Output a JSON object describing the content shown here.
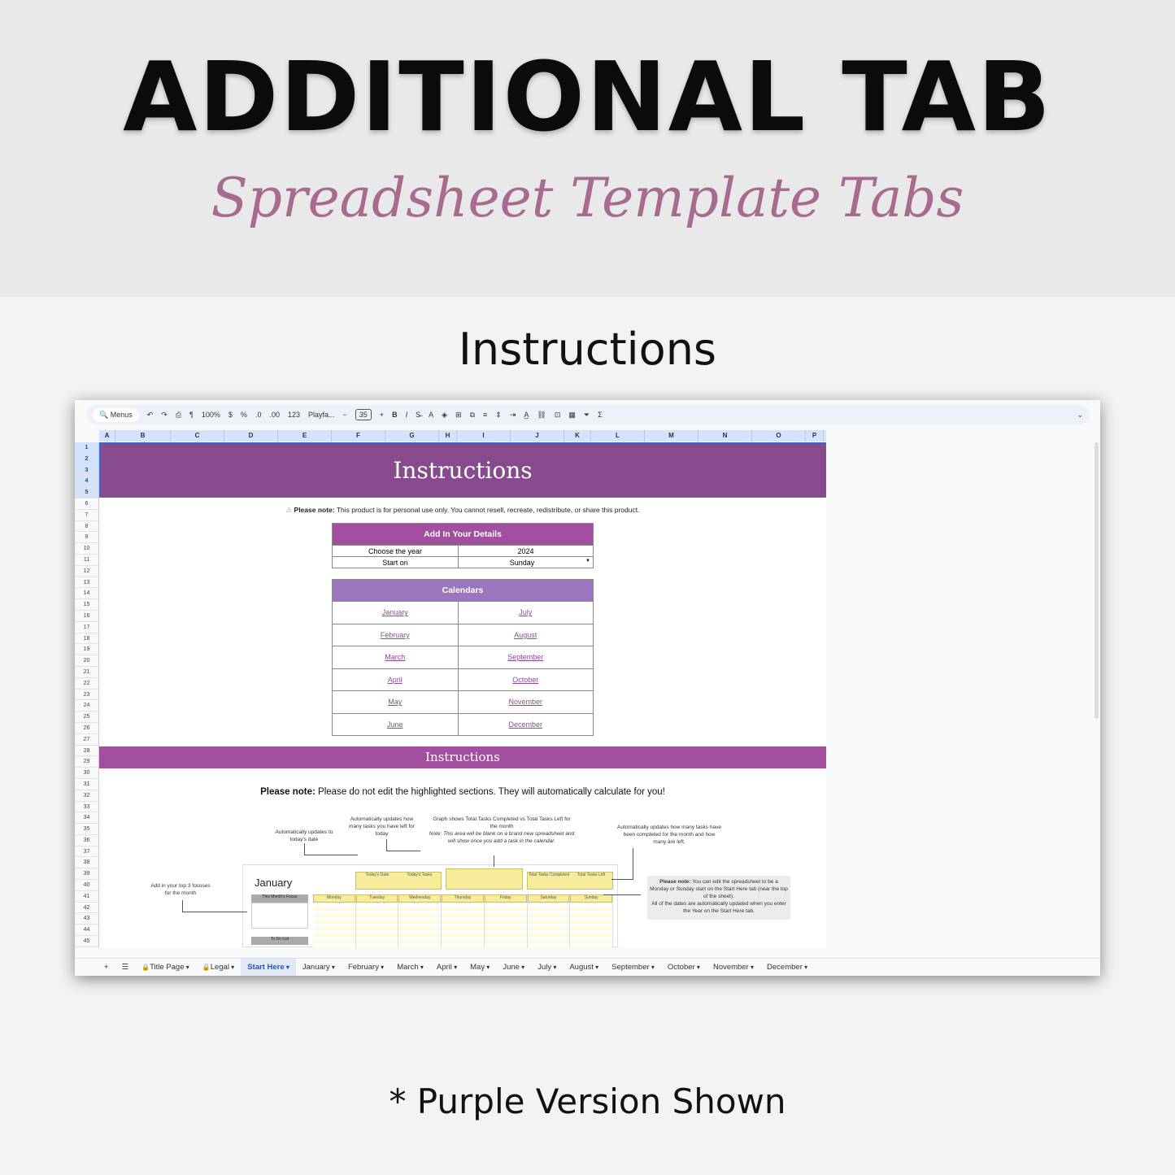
{
  "hero": {
    "title": "ADDITIONAL TAB",
    "subtitle": "Spreadsheet Template Tabs",
    "section": "Instructions",
    "footer": "* Purple Version Shown"
  },
  "toolbar": {
    "search": "Menus",
    "zoom": "100%",
    "currency": "$",
    "percent": "%",
    "dec_minus": ".0",
    "dec_plus": ".00",
    "format": "123",
    "font": "Playfa...",
    "font_size": "35",
    "bold": "B",
    "italic": "I"
  },
  "columns": [
    "A",
    "B",
    "C",
    "D",
    "E",
    "F",
    "G",
    "H",
    "I",
    "J",
    "K",
    "L",
    "M",
    "N",
    "O",
    "P"
  ],
  "sheet": {
    "banner": "Instructions",
    "note_label": "Please note:",
    "note_text": " This product is for personal use only. You cannot resell, recreate, redistribute, or share this product.",
    "details": {
      "header": "Add In Your Details",
      "rows": [
        [
          "Choose the year",
          "2024"
        ],
        [
          "Start on",
          "Sunday"
        ]
      ]
    },
    "calendars": {
      "header": "Calendars",
      "rows": [
        [
          "January",
          "July"
        ],
        [
          "February",
          "August"
        ],
        [
          "March",
          "September"
        ],
        [
          "April",
          "October"
        ],
        [
          "May",
          "November"
        ],
        [
          "June",
          "December"
        ]
      ]
    },
    "instructions_bar": "Instructions",
    "note2_label": "Please note:",
    "note2_text": " Please do not edit the highlighted sections. They will automatically calculate for you!",
    "preview": {
      "month": "January",
      "ann_date": "Automatically updates to today's date",
      "ann_tasks": "Automatically updates how many tasks you have left for today",
      "ann_graph": "Graph shows Total Tasks Completed vs Total Tasks Left for the month",
      "ann_graph_note": "Note: This area will be blank on a brand new spreadsheet and will show once you add a task in the calendar.",
      "ann_completed": "Automatically updates how many tasks have been completed for the month and how many are left.",
      "ann_focus": "Add in your top 3 focuses for the month",
      "side_note_label": "Please note:",
      "side_note_text": " You can edit the spreadsheet to be a Monday or Sunday start on the Start Here tab (near the top of the sheet).",
      "side_note_2": "All of the dates are automatically updated when you enter the Year on the Start Here tab.",
      "focus_header": "This Month's Focus",
      "todo_header": "To Do List",
      "stat_headers": [
        "Today's Date",
        "Today's Tasks",
        "Total Tasks Completed",
        "Total Tasks Left"
      ],
      "days": [
        "Monday",
        "Tuesday",
        "Wednesday",
        "Thursday",
        "Friday",
        "Saturday",
        "Sunday"
      ]
    }
  },
  "tabs": [
    {
      "label": "Title Page",
      "lock": true
    },
    {
      "label": "Legal",
      "lock": true
    },
    {
      "label": "Start Here",
      "active": true
    },
    {
      "label": "January"
    },
    {
      "label": "February"
    },
    {
      "label": "March"
    },
    {
      "label": "April"
    },
    {
      "label": "May"
    },
    {
      "label": "June"
    },
    {
      "label": "July"
    },
    {
      "label": "August"
    },
    {
      "label": "September"
    },
    {
      "label": "October"
    },
    {
      "label": "November"
    },
    {
      "label": "December"
    }
  ],
  "colors": {
    "banner": "#874a8d",
    "details_header": "#a24f9f",
    "calendars_header": "#9b76bd",
    "link": "#8b4a93",
    "highlight": "#f7ec9a"
  }
}
